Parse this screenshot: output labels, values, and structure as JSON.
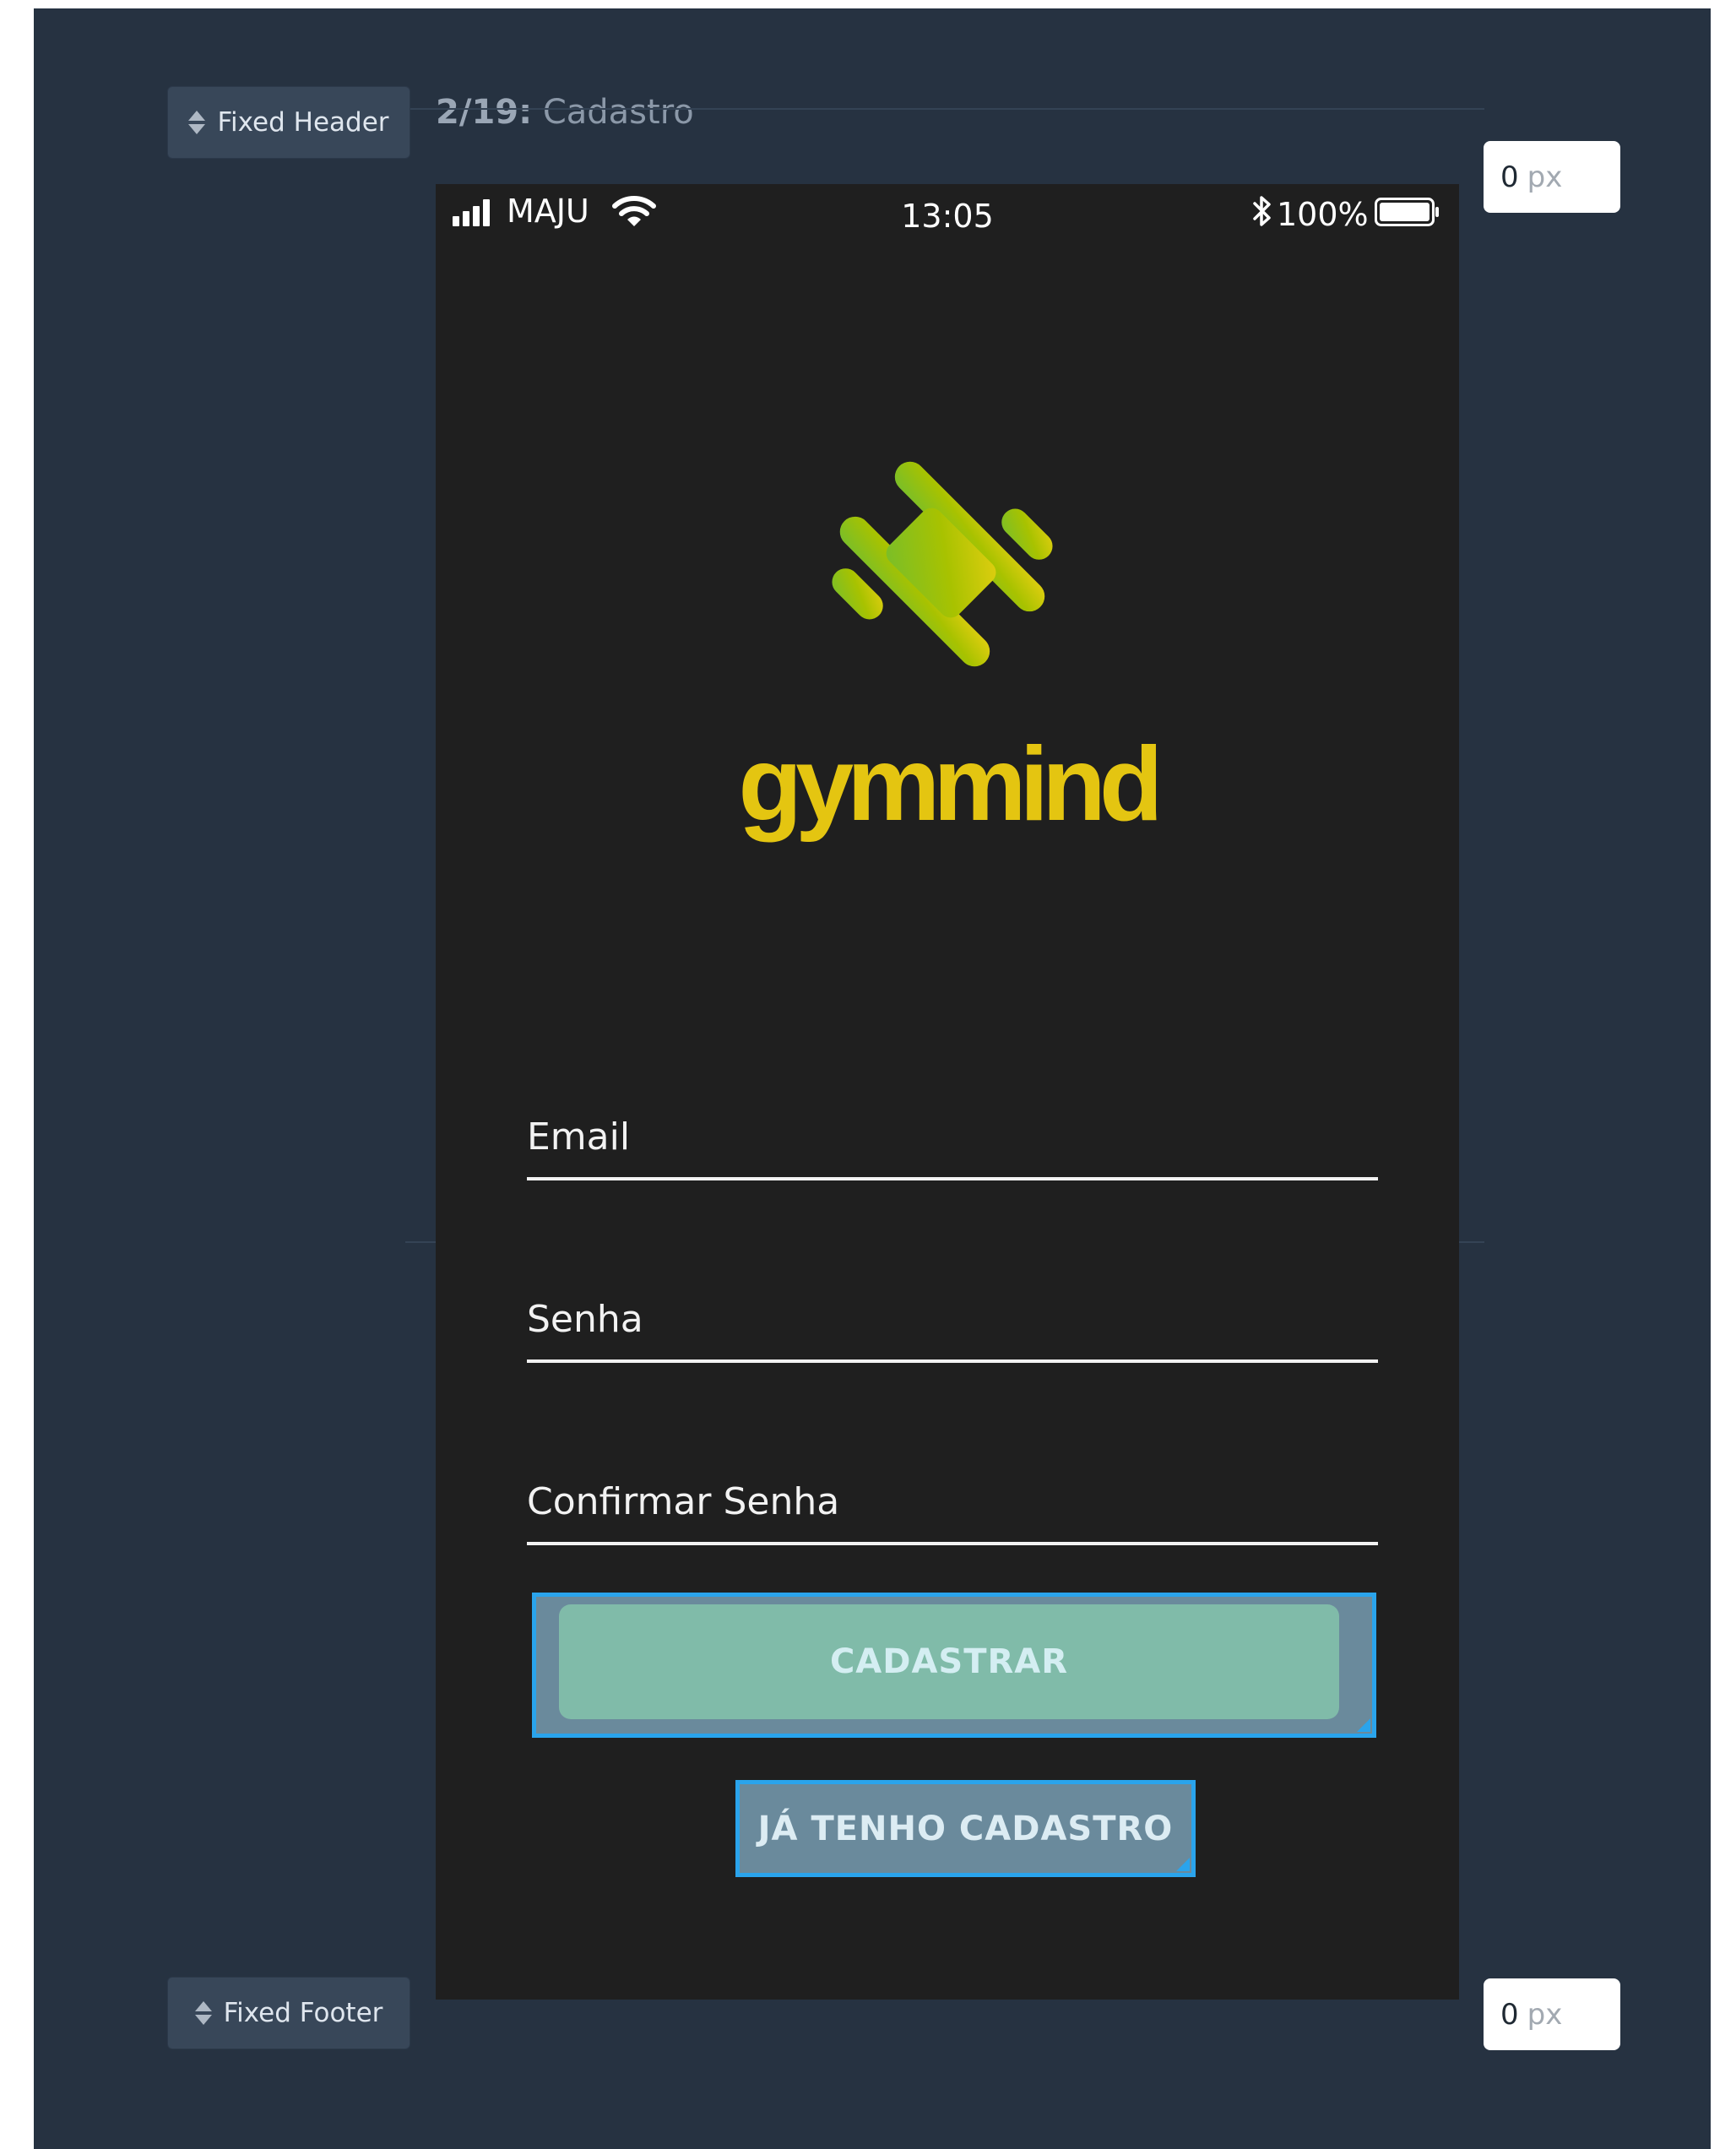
{
  "screen": {
    "index": "2/19:",
    "name": "Cadastro"
  },
  "header_control": {
    "label": "Fixed Header",
    "value": "0",
    "unit": "px"
  },
  "footer_control": {
    "label": "Fixed Footer",
    "value": "0",
    "unit": "px"
  },
  "status_bar": {
    "carrier": "MAJU",
    "time": "13:05",
    "battery": "100%"
  },
  "app": {
    "brand": "gymmind",
    "fields": [
      "Email",
      "Senha",
      "Confirmar Senha"
    ],
    "primary_button": "CADASTRAR",
    "secondary_button": "JÁ TENHO CADASTRO"
  },
  "colors": {
    "canvas_bg": "#263241",
    "phone_bg": "#1f1f1f",
    "brand_yellow": "#e4c511",
    "logo_green": "#8cc21e",
    "primary_button_bg": "#80bba9",
    "selection_blue": "#2aa4ec"
  }
}
